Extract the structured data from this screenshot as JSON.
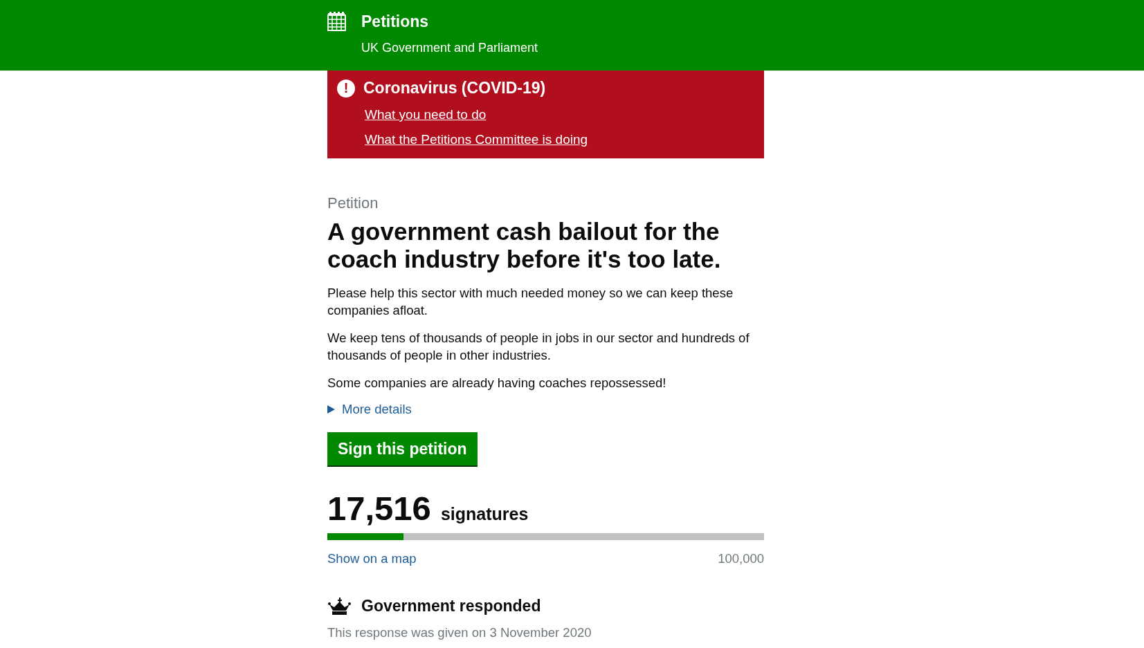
{
  "header": {
    "title": "Petitions",
    "subtitle": "UK Government and Parliament"
  },
  "alert": {
    "icon": "!",
    "title": "Coronavirus (COVID-19)",
    "links": [
      "What you need to do",
      "What the Petitions Committee is doing"
    ]
  },
  "petition": {
    "label": "Petition",
    "title": "A government cash bailout for the coach industry before it's too late.",
    "paragraphs": [
      "Please help this sector with much needed money so we can keep these companies afloat.",
      "We keep tens of thousands of people in jobs in our sector and hundreds of thousands of people in other industries.",
      "Some companies are already having coaches repossessed!"
    ],
    "details": {
      "label": "More details",
      "expanded": false
    },
    "sign_button": "Sign this petition"
  },
  "signatures": {
    "count": "17,516",
    "label": "signatures",
    "level": 0.175,
    "map_link": "Show on a map",
    "target": "100,000"
  },
  "response": {
    "title": "Government responded",
    "note": "This response was given on 3 November 2020"
  }
}
